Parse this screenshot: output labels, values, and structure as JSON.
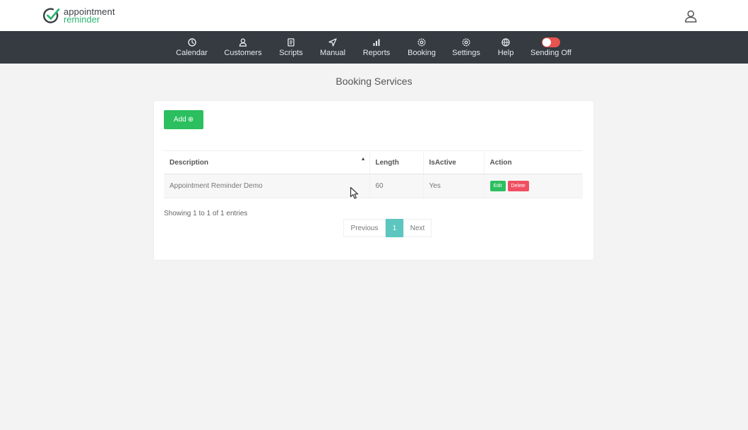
{
  "brand": {
    "line1": "appointment",
    "line2": "reminder",
    "green": "#2bb673",
    "dark": "#3a3f44"
  },
  "nav": {
    "items": [
      {
        "label": "Calendar",
        "icon": "clock-icon"
      },
      {
        "label": "Customers",
        "icon": "user-icon"
      },
      {
        "label": "Scripts",
        "icon": "document-icon"
      },
      {
        "label": "Manual",
        "icon": "send-icon"
      },
      {
        "label": "Reports",
        "icon": "bar-chart-icon"
      },
      {
        "label": "Booking",
        "icon": "gear-icon"
      },
      {
        "label": "Settings",
        "icon": "gear-icon"
      },
      {
        "label": "Help",
        "icon": "globe-icon"
      }
    ],
    "sending_label": "Sending Off",
    "sending_on": false,
    "bg": "#353b41"
  },
  "page": {
    "title": "Booking Services"
  },
  "toolbar": {
    "add_label": "Add",
    "add_icon": "plus-circle-icon"
  },
  "table": {
    "headers": [
      "Description",
      "Length",
      "IsActive",
      "Action"
    ],
    "rows": [
      {
        "description": "Appointment Reminder Demo",
        "length": "60",
        "is_active": "Yes",
        "edit_label": "Edit",
        "delete_label": "Delete"
      }
    ]
  },
  "pagination": {
    "info": "Showing 1 to 1 of 1 entries",
    "previous": "Previous",
    "current": "1",
    "next": "Next"
  },
  "colors": {
    "accent_green": "#2bbf5f",
    "danger_red": "#f04f61",
    "page_active": "#5cc6bf"
  }
}
